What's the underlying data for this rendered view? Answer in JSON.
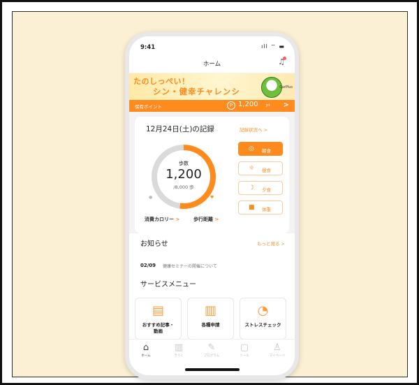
{
  "status_bar": {
    "time": "9:41",
    "icons": "ıll ⌔ ▬"
  },
  "app": {
    "title": "ホーム"
  },
  "banner": {
    "line1": "たのしっぺい！",
    "line2": "シン・健幸チャレンシ",
    "mascot_tag": "CarPlus",
    "points_label": "保有ポイント",
    "points_icon": "P",
    "points_value": "1,200",
    "points_unit": "pt",
    "points_arrow": ">"
  },
  "record": {
    "title": "12月24日(土)の記録",
    "link": "記録状況へ >",
    "steps_label": "歩数",
    "steps_value": "1,200",
    "steps_goal": "/8,000 歩",
    "progress": 0.52,
    "meals": [
      {
        "label": "朝食",
        "icon": "◎",
        "active": true
      },
      {
        "label": "昼食",
        "icon": "☼",
        "active": false
      },
      {
        "label": "夕食",
        "icon": "☽",
        "active": false
      },
      {
        "label": "体重",
        "icon": "■",
        "active": false
      }
    ],
    "calorie_link": "消費カロリー",
    "distance_link": "歩行距離",
    "arrow": ">"
  },
  "notice": {
    "title": "お知らせ",
    "more": "もっと見る >",
    "date": "02/09",
    "text": "健康セミナーの開催について"
  },
  "service_menu": {
    "title": "サービスメニュー",
    "tiles": [
      {
        "label": "おすすめ記事・\n動画",
        "icon": "▤"
      },
      {
        "label": "各種申請",
        "icon": "▥"
      },
      {
        "label": "ストレスチェック",
        "icon": "◔"
      }
    ]
  },
  "tabs": [
    {
      "label": "ホーム",
      "icon": "⌂",
      "active": true
    },
    {
      "label": "きろく",
      "icon": "▥",
      "active": false
    },
    {
      "label": "プログラム",
      "icon": "✎",
      "active": false
    },
    {
      "label": "ツール",
      "icon": "▢",
      "active": false
    },
    {
      "label": "マイページ",
      "icon": "♙",
      "active": false
    }
  ],
  "colors": {
    "accent": "#ff8a1e",
    "background": "#fbf0d4"
  }
}
